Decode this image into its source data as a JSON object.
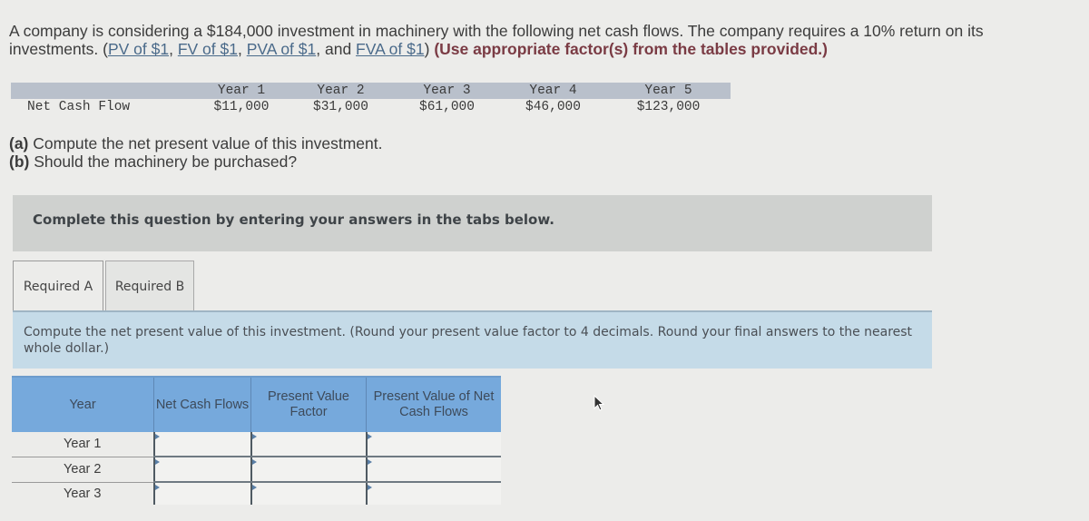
{
  "intro": {
    "text_before": "A company is considering a $184,000 investment in machinery with the following net cash flows. The company requires a 10% return on its investments. (",
    "links": [
      "PV of $1",
      "FV of $1",
      "PVA of $1",
      "FVA of $1"
    ],
    "sep1": ", ",
    "sep2": ", ",
    "sep3": ", and ",
    "close_paren": ") ",
    "bold_note": "(Use appropriate factor(s) from the tables provided.)"
  },
  "cash_flow_table": {
    "row_label": "Net Cash Flow",
    "years": [
      "Year 1",
      "Year 2",
      "Year 3",
      "Year 4",
      "Year 5"
    ],
    "values": [
      "$11,000",
      "$31,000",
      "$61,000",
      "$46,000",
      "$123,000"
    ]
  },
  "parts": {
    "a_marker": "(a)",
    "a_text": " Compute the net present value of this investment.",
    "b_marker": "(b)",
    "b_text": " Should the machinery be purchased?"
  },
  "instruction_bar": "Complete this question by entering your answers in the tabs below.",
  "tabs": [
    {
      "label": "Required A",
      "active": true
    },
    {
      "label": "Required B",
      "active": false
    }
  ],
  "prompt": "Compute the net present value of this investment. (Round your present value factor to 4 decimals. Round your final answers to the nearest whole dollar.)",
  "npv_table": {
    "headers": {
      "year": "Year",
      "ncf": "Net Cash Flows",
      "pvf": "Present Value Factor",
      "pv": "Present Value of Net Cash Flows"
    },
    "rows": [
      {
        "year": "Year 1",
        "ncf": "",
        "pvf": "",
        "pv": ""
      },
      {
        "year": "Year 2",
        "ncf": "",
        "pvf": "",
        "pv": ""
      },
      {
        "year": "Year 3",
        "ncf": "",
        "pvf": "",
        "pv": ""
      }
    ]
  }
}
